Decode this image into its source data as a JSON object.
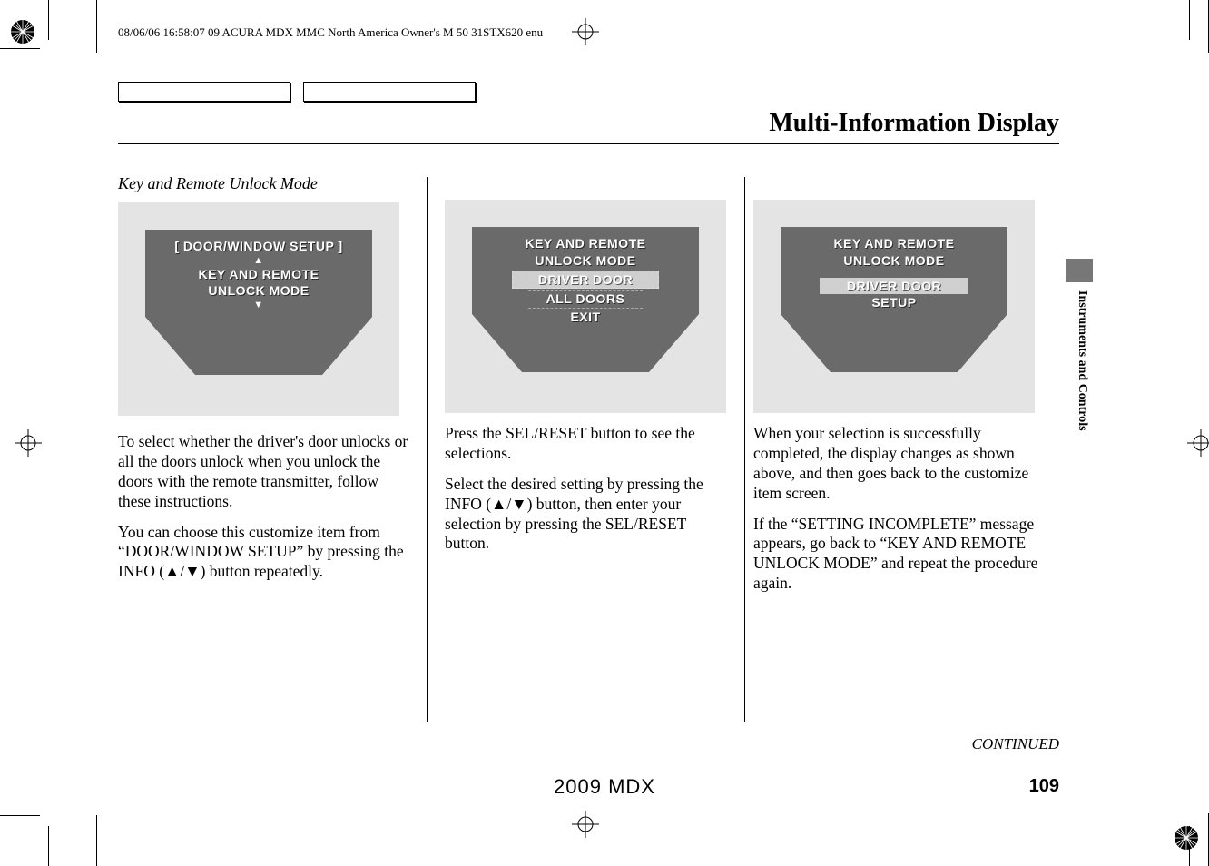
{
  "meta": {
    "header": "08/06/06 16:58:07   09 ACURA MDX MMC North America Owner's M 50 31STX620 enu"
  },
  "page": {
    "title": "Multi-Information Display",
    "side_tab": "Instruments and Controls",
    "continued": "CONTINUED",
    "model": "2009  MDX",
    "number": "109"
  },
  "col1": {
    "subheading": "Key and Remote Unlock Mode",
    "diagram": {
      "line1": "[ DOOR/WINDOW SETUP ]",
      "arrow_up": "▲",
      "line2": "KEY AND REMOTE",
      "line3": "UNLOCK MODE",
      "arrow_down": "▼"
    },
    "para1": "To select whether the driver's door unlocks or all the doors unlock when you unlock the doors with the remote transmitter, follow these instructions.",
    "para2_a": "You can choose this customize item from “DOOR/WINDOW SETUP” by pressing the INFO (",
    "para2_b": ") button repeatedly."
  },
  "col2": {
    "diagram": {
      "line1": "KEY AND REMOTE",
      "line2": "UNLOCK MODE",
      "opt1": "DRIVER DOOR",
      "opt2": "ALL DOORS",
      "opt3": "EXIT"
    },
    "para1": "Press the SEL/RESET button to see the selections.",
    "para2_a": "Select the desired setting by pressing the INFO (",
    "para2_b": ") button, then enter your selection by pressing the SEL/RESET button."
  },
  "col3": {
    "diagram": {
      "line1": "KEY AND REMOTE",
      "line2": "UNLOCK MODE",
      "opt1": "DRIVER DOOR",
      "opt2": "SETUP"
    },
    "para1": "When your selection is successfully completed, the display changes as shown above, and then goes back to the customize item screen.",
    "para2": "If the “SETTING INCOMPLETE” message appears, go back to “KEY AND REMOTE UNLOCK MODE” and repeat the procedure again."
  },
  "glyphs": {
    "up": "▲",
    "down": "▼",
    "slash": "/"
  }
}
